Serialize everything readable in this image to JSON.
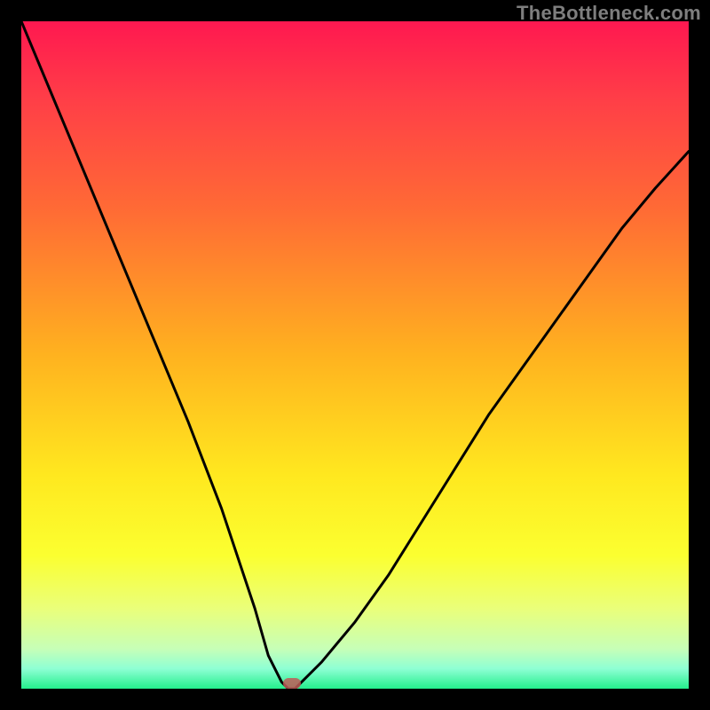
{
  "watermark": "TheBottleneck.com",
  "colors": {
    "background": "#000000",
    "curve_stroke": "#000000",
    "marker": "#c05b57"
  },
  "chart_data": {
    "type": "line",
    "title": "",
    "xlabel": "",
    "ylabel": "",
    "xlim": [
      0,
      100
    ],
    "ylim": [
      0,
      100
    ],
    "series": [
      {
        "name": "bottleneck-curve",
        "x": [
          0,
          5,
          10,
          15,
          20,
          25,
          30,
          35,
          37,
          39,
          40,
          41,
          42,
          45,
          50,
          55,
          60,
          65,
          70,
          75,
          80,
          85,
          90,
          95,
          100
        ],
        "y": [
          100,
          88,
          76,
          64,
          52,
          40,
          27,
          12,
          5,
          1,
          0,
          0,
          1,
          4,
          10,
          17,
          25,
          33,
          41,
          48,
          55,
          62,
          69,
          75,
          80.5
        ]
      }
    ],
    "marker": {
      "x": 40.5,
      "y": 0
    },
    "grid": false,
    "legend": false
  }
}
